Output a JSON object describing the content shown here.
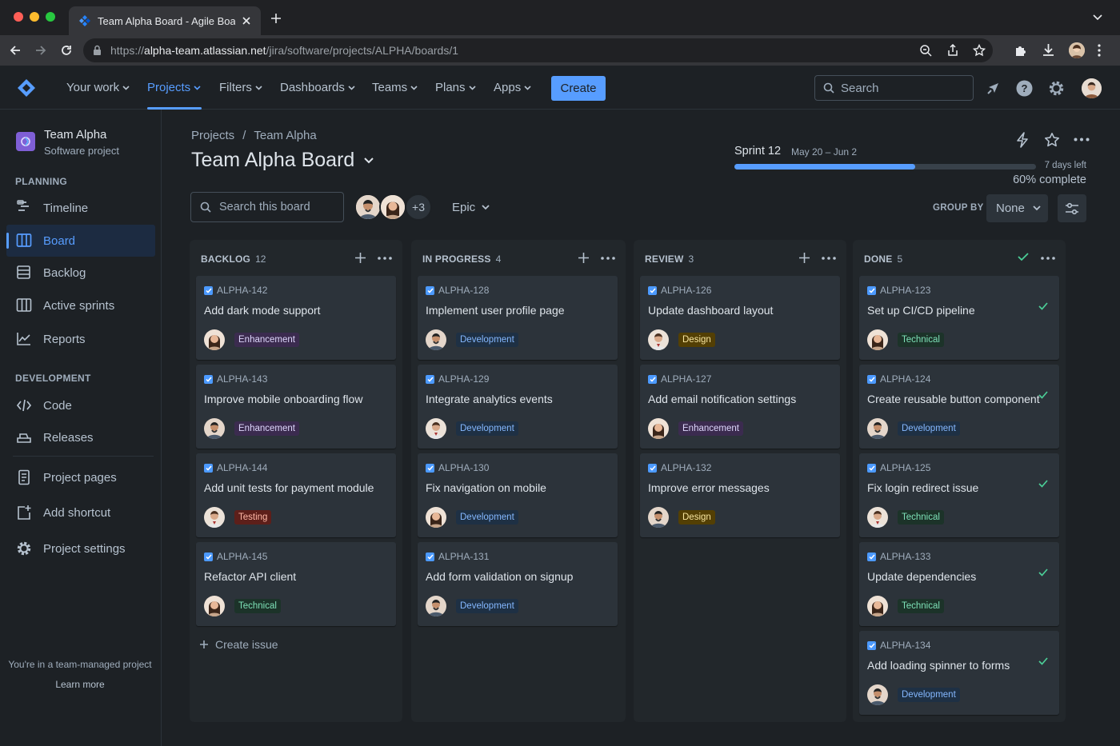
{
  "browser": {
    "tab_title": "Team Alpha Board - Agile Board",
    "url_scheme": "https://",
    "url_host": "alpha-team.atlassian.net",
    "url_path": "/jira/software/projects/ALPHA/boards/1"
  },
  "nav": {
    "items": [
      {
        "label": "Your work",
        "active": false
      },
      {
        "label": "Projects",
        "active": true
      },
      {
        "label": "Filters",
        "active": false
      },
      {
        "label": "Dashboards",
        "active": false
      },
      {
        "label": "Teams",
        "active": false
      },
      {
        "label": "Plans",
        "active": false
      },
      {
        "label": "Apps",
        "active": false
      }
    ],
    "create_label": "Create",
    "search_placeholder": "Search"
  },
  "sidebar": {
    "project_name": "Team Alpha",
    "project_type": "Software project",
    "planning_heading": "PLANNING",
    "planning_items": [
      "Timeline",
      "Board",
      "Backlog",
      "Active sprints",
      "Reports"
    ],
    "development_heading": "DEVELOPMENT",
    "development_items": [
      "Code",
      "Releases"
    ],
    "extra_items": [
      "Project pages",
      "Add shortcut",
      "Project settings"
    ],
    "footer_text": "You're in a team-managed project",
    "footer_link": "Learn more"
  },
  "board": {
    "breadcrumb_projects": "Projects",
    "breadcrumb_sep": "/",
    "breadcrumb_team": "Team Alpha",
    "title": "Team Alpha Board",
    "search_placeholder": "Search this board",
    "more_avatars": "+3",
    "epic_label": "Epic",
    "group_by_label": "GROUP BY",
    "group_by_value": "None",
    "create_issue": "Create issue"
  },
  "sprint": {
    "name": "Sprint 12",
    "dates": "May 20 – Jun 2",
    "days_left": "7 days left",
    "progress_pct": 60,
    "complete_label": "60% complete"
  },
  "colors": {
    "accent": "#579dff",
    "done_check": "#4bce97"
  },
  "columns": [
    {
      "title": "BACKLOG",
      "count": "12",
      "cards": [
        {
          "key": "ALPHA-142",
          "title": "Add dark mode support",
          "label": "Enhancement"
        },
        {
          "key": "ALPHA-143",
          "title": "Improve mobile onboarding flow",
          "label": "Enhancement"
        },
        {
          "key": "ALPHA-144",
          "title": "Add unit tests for payment module",
          "label": "Testing"
        },
        {
          "key": "ALPHA-145",
          "title": "Refactor API client",
          "label": "Technical"
        }
      ]
    },
    {
      "title": "IN PROGRESS",
      "count": "4",
      "cards": [
        {
          "key": "ALPHA-128",
          "title": "Implement user profile page",
          "label": "Development"
        },
        {
          "key": "ALPHA-129",
          "title": "Integrate analytics events",
          "label": "Development"
        },
        {
          "key": "ALPHA-130",
          "title": "Fix navigation on mobile",
          "label": "Development"
        },
        {
          "key": "ALPHA-131",
          "title": "Add form validation on signup",
          "label": "Development"
        }
      ]
    },
    {
      "title": "REVIEW",
      "count": "3",
      "cards": [
        {
          "key": "ALPHA-126",
          "title": "Update dashboard layout",
          "label": "Design"
        },
        {
          "key": "ALPHA-127",
          "title": "Add email notification settings",
          "label": "Enhancement"
        },
        {
          "key": "ALPHA-132",
          "title": "Improve error messages",
          "label": "Design"
        }
      ]
    },
    {
      "title": "DONE",
      "count": "5",
      "cards": [
        {
          "key": "ALPHA-123",
          "title": "Set up CI/CD pipeline",
          "label": "Technical"
        },
        {
          "key": "ALPHA-124",
          "title": "Create reusable button component",
          "label": "Development"
        },
        {
          "key": "ALPHA-125",
          "title": "Fix login redirect issue",
          "label": "Technical"
        },
        {
          "key": "ALPHA-133",
          "title": "Update dependencies",
          "label": "Technical"
        },
        {
          "key": "ALPHA-134",
          "title": "Add loading spinner to forms",
          "label": "Development"
        }
      ]
    }
  ]
}
